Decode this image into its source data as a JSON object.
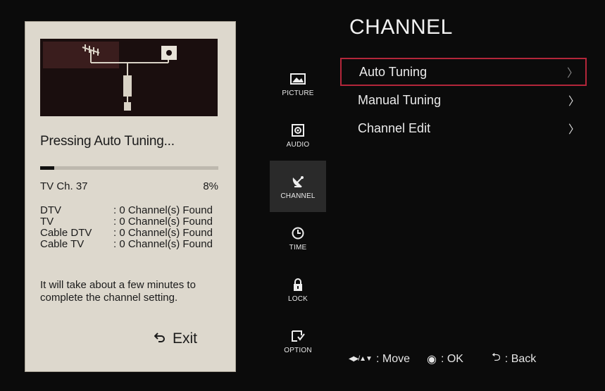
{
  "popup": {
    "heading": "Pressing Auto Tuning...",
    "progress": 0.08,
    "channel": "TV Ch. 37",
    "percent": "8%",
    "found": [
      {
        "type": "DTV",
        "value": ": 0 Channel(s) Found"
      },
      {
        "type": "TV",
        "value": ": 0 Channel(s) Found"
      },
      {
        "type": "Cable DTV",
        "value": ": 0 Channel(s) Found"
      },
      {
        "type": "Cable TV",
        "value": ": 0 Channel(s) Found"
      }
    ],
    "note_line1": "It will take about a few minutes to",
    "note_line2": "complete the channel setting.",
    "exit_label": "Exit"
  },
  "sidemenu": {
    "items": [
      {
        "label": "PICTURE",
        "icon": "picture-icon"
      },
      {
        "label": "AUDIO",
        "icon": "audio-icon"
      },
      {
        "label": "CHANNEL",
        "icon": "satellite-icon",
        "active": true
      },
      {
        "label": "TIME",
        "icon": "clock-icon"
      },
      {
        "label": "LOCK",
        "icon": "lock-icon"
      },
      {
        "label": "OPTION",
        "icon": "option-icon"
      }
    ]
  },
  "panel": {
    "title": "CHANNEL",
    "items": [
      {
        "label": "Auto Tuning",
        "arrow": "〉"
      },
      {
        "label": "Manual Tuning",
        "arrow": "〉"
      },
      {
        "label": "Channel Edit",
        "arrow": "〉"
      }
    ]
  },
  "footer": {
    "nav_keys": "◀▶/▲▼",
    "move": ": Move",
    "ok_key": "◉",
    "ok": ": OK",
    "back_key": "⮌",
    "back": ": Back"
  },
  "colors": {
    "popup_bg": "#ddd8cd",
    "selection_border": "#b3263a",
    "active_tab_bg": "#2a2a2a"
  }
}
